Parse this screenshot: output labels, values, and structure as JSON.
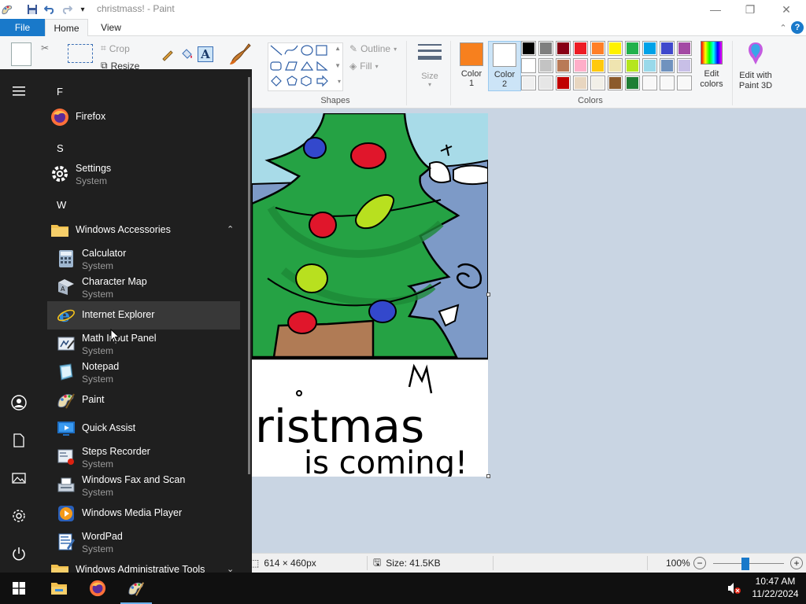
{
  "window": {
    "title": "christmass! - Paint",
    "minimize_glyph": "—",
    "restore_glyph": "❐",
    "close_glyph": "✕"
  },
  "tabs": {
    "file": "File",
    "home": "Home",
    "view": "View"
  },
  "ribbon": {
    "crop": "Crop",
    "resize": "Resize",
    "outline": "Outline",
    "fill": "Fill",
    "size": "Size",
    "color1": "Color\n1",
    "color2": "Color\n2",
    "edit_colors": "Edit\ncolors",
    "edit_3d": "Edit with\nPaint 3D",
    "shapes_label": "Shapes",
    "colors_label": "Colors",
    "color1_value": "#f7801e",
    "color2_value": "#ffffff"
  },
  "palette": [
    [
      "#000000",
      "#7f7f7f",
      "#880015",
      "#ed1c24",
      "#ff7f27",
      "#fff200",
      "#22b14c",
      "#00a2e8",
      "#3f48cc",
      "#a349a4"
    ],
    [
      "#ffffff",
      "#c3c3c3",
      "#b97a57",
      "#ffaec9",
      "#ffc90e",
      "#efe4b0",
      "#b5e61d",
      "#99d9ea",
      "#7092be",
      "#c8bfe7"
    ],
    [
      "#f0f0f0",
      "#e6e6e6",
      "#c00000",
      "#e8d6c0",
      "#f2f0e8",
      "#8b5a2b",
      "#1e7e34",
      "#f8f8f8",
      "#f8f8f8",
      "#f8f8f8"
    ]
  ],
  "canvas_text": {
    "line1": "ristmas",
    "line2": "is coming!"
  },
  "status": {
    "dimensions": "614 × 460px",
    "size": "Size: 41.5KB",
    "zoom": "100%",
    "zoom_level": 0.45
  },
  "start_menu": {
    "letters": {
      "f": "F",
      "s": "S",
      "w": "W"
    },
    "apps": {
      "firefox": {
        "name": "Firefox"
      },
      "settings": {
        "name": "Settings",
        "meta": "System"
      },
      "win_accessories": {
        "name": "Windows Accessories"
      },
      "calculator": {
        "name": "Calculator",
        "meta": "System"
      },
      "charmap": {
        "name": "Character Map",
        "meta": "System"
      },
      "ie": {
        "name": "Internet Explorer"
      },
      "math": {
        "name": "Math Input Panel",
        "meta": "System"
      },
      "notepad": {
        "name": "Notepad",
        "meta": "System"
      },
      "paint": {
        "name": "Paint"
      },
      "quickassist": {
        "name": "Quick Assist"
      },
      "steps": {
        "name": "Steps Recorder",
        "meta": "System"
      },
      "fax": {
        "name": "Windows Fax and Scan",
        "meta": "System"
      },
      "wmp": {
        "name": "Windows Media Player"
      },
      "wordpad": {
        "name": "WordPad",
        "meta": "System"
      },
      "admin": {
        "name": "Windows Administrative Tools"
      }
    }
  },
  "taskbar": {
    "time": "10:47 AM",
    "date": "11/22/2024"
  }
}
